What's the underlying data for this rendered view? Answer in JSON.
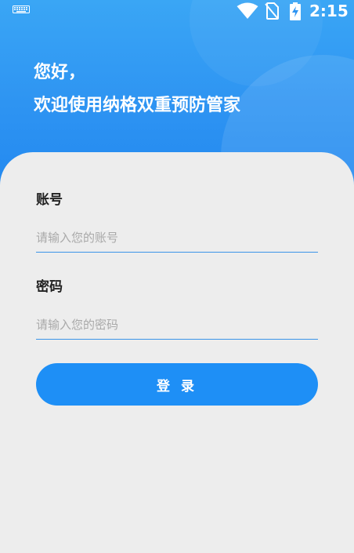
{
  "status_bar": {
    "time": "2:15",
    "icons": [
      "keyboard-icon",
      "wifi-icon",
      "no-sim-icon",
      "battery-charging-icon"
    ]
  },
  "header": {
    "greeting": "您好，",
    "welcome": "欢迎使用纳格双重预防管家"
  },
  "form": {
    "account": {
      "label": "账号",
      "placeholder": "请输入您的账号",
      "value": ""
    },
    "password": {
      "label": "密码",
      "placeholder": "请输入您的密码",
      "value": ""
    },
    "login_label": "登 录"
  },
  "colors": {
    "primary": "#1e8ff6",
    "header_top": "#3aa6f5",
    "header_bottom": "#2389f0",
    "card_bg": "#ededed",
    "underline": "#3b94e8",
    "placeholder": "#a9a9a9"
  }
}
